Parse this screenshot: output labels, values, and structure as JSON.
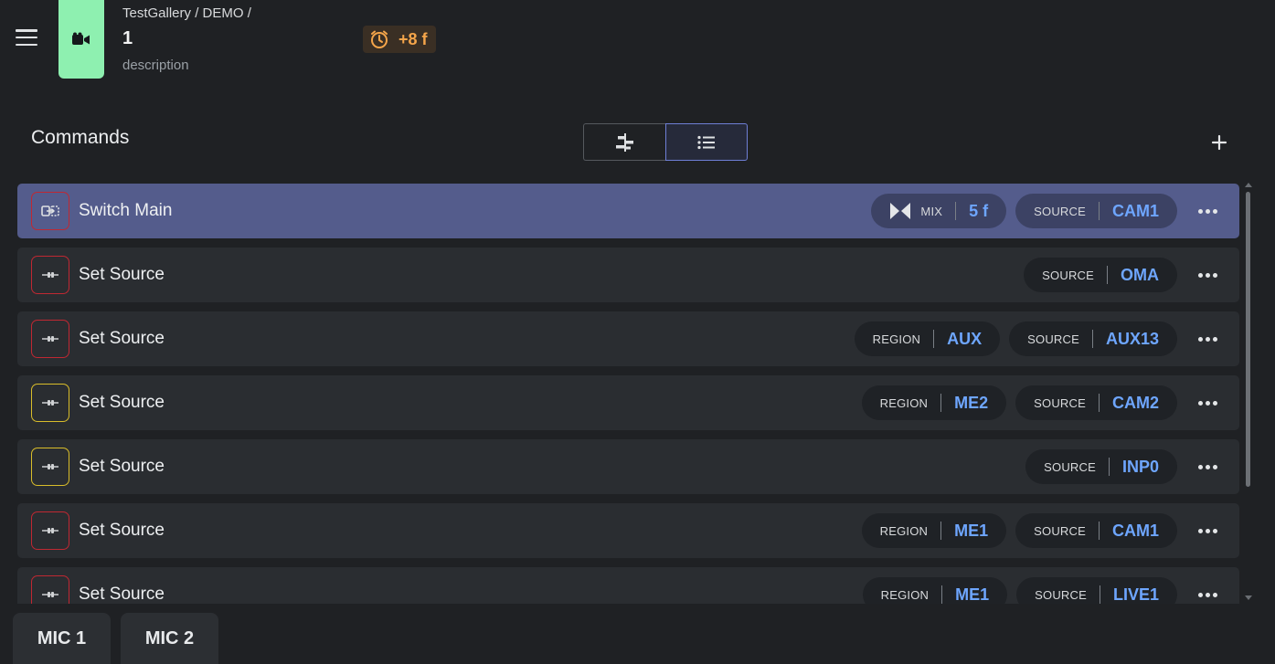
{
  "header": {
    "breadcrumb": "TestGallery / DEMO /",
    "title": "1",
    "description": "description",
    "timer": "+8 f",
    "tile_color": "#8ef0b0"
  },
  "toolbar": {
    "section_title": "Commands",
    "views": [
      "timeline-view",
      "list-view"
    ],
    "active_view": "list-view"
  },
  "commands": [
    {
      "name": "Switch Main",
      "icon_border": "red",
      "selected": true,
      "params": [
        {
          "label": "MIX",
          "value": "5 f",
          "icon": "mix-transition-icon"
        },
        {
          "label": "SOURCE",
          "value": "CAM1"
        }
      ]
    },
    {
      "name": "Set Source",
      "icon_border": "red",
      "selected": false,
      "params": [
        {
          "label": "SOURCE",
          "value": "OMA"
        }
      ]
    },
    {
      "name": "Set Source",
      "icon_border": "red",
      "selected": false,
      "params": [
        {
          "label": "REGION",
          "value": "AUX"
        },
        {
          "label": "SOURCE",
          "value": "AUX13"
        }
      ]
    },
    {
      "name": "Set Source",
      "icon_border": "yellow",
      "selected": false,
      "params": [
        {
          "label": "REGION",
          "value": "ME2"
        },
        {
          "label": "SOURCE",
          "value": "CAM2"
        }
      ]
    },
    {
      "name": "Set Source",
      "icon_border": "yellow",
      "selected": false,
      "params": [
        {
          "label": "SOURCE",
          "value": "INP0"
        }
      ]
    },
    {
      "name": "Set Source",
      "icon_border": "red",
      "selected": false,
      "params": [
        {
          "label": "REGION",
          "value": "ME1"
        },
        {
          "label": "SOURCE",
          "value": "CAM1"
        }
      ]
    },
    {
      "name": "Set Source",
      "icon_border": "red",
      "selected": false,
      "params": [
        {
          "label": "REGION",
          "value": "ME1"
        },
        {
          "label": "SOURCE",
          "value": "LIVE1"
        }
      ]
    }
  ],
  "bottom_tabs": [
    "MIC 1",
    "MIC 2"
  ],
  "colors": {
    "accent_value": "#6ea6ff",
    "selected_row": "#545c8c",
    "timer": "#f5a54a",
    "icon_red": "#c02832",
    "icon_yellow": "#d9bd2a"
  }
}
